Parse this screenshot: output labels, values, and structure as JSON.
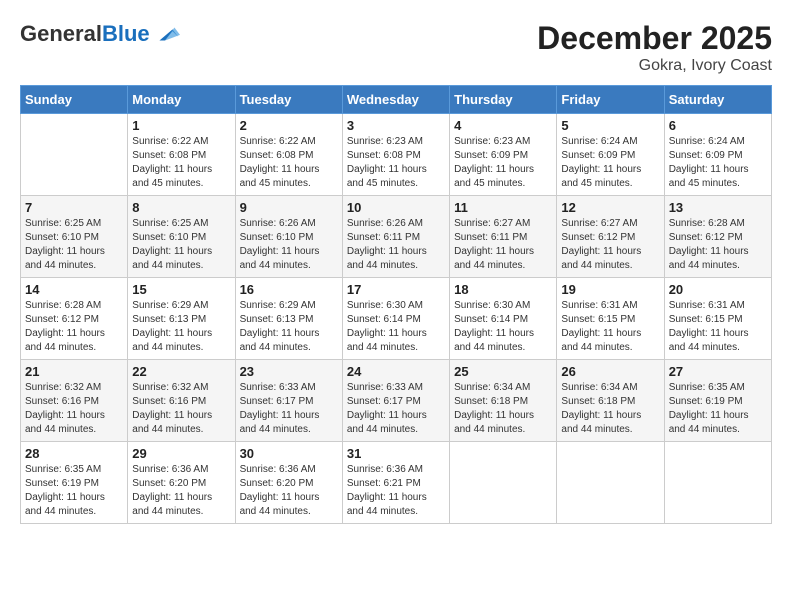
{
  "header": {
    "logo_general": "General",
    "logo_blue": "Blue",
    "month_year": "December 2025",
    "location": "Gokra, Ivory Coast"
  },
  "weekdays": [
    "Sunday",
    "Monday",
    "Tuesday",
    "Wednesday",
    "Thursday",
    "Friday",
    "Saturday"
  ],
  "weeks": [
    [
      {
        "day": "",
        "info": ""
      },
      {
        "day": "1",
        "info": "Sunrise: 6:22 AM\nSunset: 6:08 PM\nDaylight: 11 hours\nand 45 minutes."
      },
      {
        "day": "2",
        "info": "Sunrise: 6:22 AM\nSunset: 6:08 PM\nDaylight: 11 hours\nand 45 minutes."
      },
      {
        "day": "3",
        "info": "Sunrise: 6:23 AM\nSunset: 6:08 PM\nDaylight: 11 hours\nand 45 minutes."
      },
      {
        "day": "4",
        "info": "Sunrise: 6:23 AM\nSunset: 6:09 PM\nDaylight: 11 hours\nand 45 minutes."
      },
      {
        "day": "5",
        "info": "Sunrise: 6:24 AM\nSunset: 6:09 PM\nDaylight: 11 hours\nand 45 minutes."
      },
      {
        "day": "6",
        "info": "Sunrise: 6:24 AM\nSunset: 6:09 PM\nDaylight: 11 hours\nand 45 minutes."
      }
    ],
    [
      {
        "day": "7",
        "info": "Sunrise: 6:25 AM\nSunset: 6:10 PM\nDaylight: 11 hours\nand 44 minutes."
      },
      {
        "day": "8",
        "info": "Sunrise: 6:25 AM\nSunset: 6:10 PM\nDaylight: 11 hours\nand 44 minutes."
      },
      {
        "day": "9",
        "info": "Sunrise: 6:26 AM\nSunset: 6:10 PM\nDaylight: 11 hours\nand 44 minutes."
      },
      {
        "day": "10",
        "info": "Sunrise: 6:26 AM\nSunset: 6:11 PM\nDaylight: 11 hours\nand 44 minutes."
      },
      {
        "day": "11",
        "info": "Sunrise: 6:27 AM\nSunset: 6:11 PM\nDaylight: 11 hours\nand 44 minutes."
      },
      {
        "day": "12",
        "info": "Sunrise: 6:27 AM\nSunset: 6:12 PM\nDaylight: 11 hours\nand 44 minutes."
      },
      {
        "day": "13",
        "info": "Sunrise: 6:28 AM\nSunset: 6:12 PM\nDaylight: 11 hours\nand 44 minutes."
      }
    ],
    [
      {
        "day": "14",
        "info": "Sunrise: 6:28 AM\nSunset: 6:12 PM\nDaylight: 11 hours\nand 44 minutes."
      },
      {
        "day": "15",
        "info": "Sunrise: 6:29 AM\nSunset: 6:13 PM\nDaylight: 11 hours\nand 44 minutes."
      },
      {
        "day": "16",
        "info": "Sunrise: 6:29 AM\nSunset: 6:13 PM\nDaylight: 11 hours\nand 44 minutes."
      },
      {
        "day": "17",
        "info": "Sunrise: 6:30 AM\nSunset: 6:14 PM\nDaylight: 11 hours\nand 44 minutes."
      },
      {
        "day": "18",
        "info": "Sunrise: 6:30 AM\nSunset: 6:14 PM\nDaylight: 11 hours\nand 44 minutes."
      },
      {
        "day": "19",
        "info": "Sunrise: 6:31 AM\nSunset: 6:15 PM\nDaylight: 11 hours\nand 44 minutes."
      },
      {
        "day": "20",
        "info": "Sunrise: 6:31 AM\nSunset: 6:15 PM\nDaylight: 11 hours\nand 44 minutes."
      }
    ],
    [
      {
        "day": "21",
        "info": "Sunrise: 6:32 AM\nSunset: 6:16 PM\nDaylight: 11 hours\nand 44 minutes."
      },
      {
        "day": "22",
        "info": "Sunrise: 6:32 AM\nSunset: 6:16 PM\nDaylight: 11 hours\nand 44 minutes."
      },
      {
        "day": "23",
        "info": "Sunrise: 6:33 AM\nSunset: 6:17 PM\nDaylight: 11 hours\nand 44 minutes."
      },
      {
        "day": "24",
        "info": "Sunrise: 6:33 AM\nSunset: 6:17 PM\nDaylight: 11 hours\nand 44 minutes."
      },
      {
        "day": "25",
        "info": "Sunrise: 6:34 AM\nSunset: 6:18 PM\nDaylight: 11 hours\nand 44 minutes."
      },
      {
        "day": "26",
        "info": "Sunrise: 6:34 AM\nSunset: 6:18 PM\nDaylight: 11 hours\nand 44 minutes."
      },
      {
        "day": "27",
        "info": "Sunrise: 6:35 AM\nSunset: 6:19 PM\nDaylight: 11 hours\nand 44 minutes."
      }
    ],
    [
      {
        "day": "28",
        "info": "Sunrise: 6:35 AM\nSunset: 6:19 PM\nDaylight: 11 hours\nand 44 minutes."
      },
      {
        "day": "29",
        "info": "Sunrise: 6:36 AM\nSunset: 6:20 PM\nDaylight: 11 hours\nand 44 minutes."
      },
      {
        "day": "30",
        "info": "Sunrise: 6:36 AM\nSunset: 6:20 PM\nDaylight: 11 hours\nand 44 minutes."
      },
      {
        "day": "31",
        "info": "Sunrise: 6:36 AM\nSunset: 6:21 PM\nDaylight: 11 hours\nand 44 minutes."
      },
      {
        "day": "",
        "info": ""
      },
      {
        "day": "",
        "info": ""
      },
      {
        "day": "",
        "info": ""
      }
    ]
  ]
}
